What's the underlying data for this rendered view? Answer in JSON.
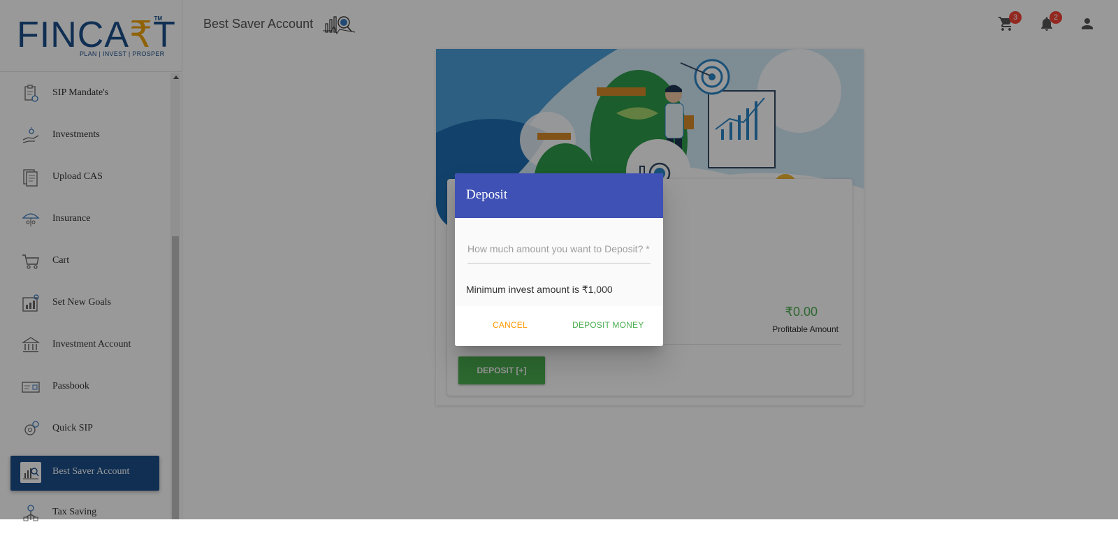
{
  "sidebar": {
    "logo": {
      "text_a": "FINCA",
      "text_rupee": "₹",
      "text_b": "T",
      "tm": "TM",
      "tagline": "PLAN | INVEST | PROSPER"
    },
    "items": [
      {
        "label": "SIP Mandate's",
        "icon": "clipboard-icon"
      },
      {
        "label": "Investments",
        "icon": "hand-money-icon"
      },
      {
        "label": "Upload CAS",
        "icon": "document-upload-icon"
      },
      {
        "label": "Insurance",
        "icon": "umbrella-family-icon"
      },
      {
        "label": "Cart",
        "icon": "cart-icon"
      },
      {
        "label": "Set New Goals",
        "icon": "goal-chart-icon"
      },
      {
        "label": "Investment Account",
        "icon": "bank-icon"
      },
      {
        "label": "Passbook",
        "icon": "passbook-icon"
      },
      {
        "label": "Quick SIP",
        "icon": "gear-money-icon"
      },
      {
        "label": "Best Saver Account",
        "icon": "analytics-icon",
        "active": true
      },
      {
        "label": "Tax Saving",
        "icon": "tax-tree-icon"
      }
    ]
  },
  "header": {
    "title": "Best Saver Account",
    "cart_badge": "3",
    "notification_badge": "2"
  },
  "card": {
    "profit_value": "₹0.00",
    "profit_label": "Profitable Amount",
    "deposit_button": "DEPOSIT [+]"
  },
  "dialog": {
    "title": "Deposit",
    "amount_placeholder": "How much amount you want to Deposit? *",
    "amount_value": "",
    "min_note": "Minimum invest amount is ₹1,000",
    "cancel_label": "CANCEL",
    "deposit_label": "DEPOSIT MONEY"
  },
  "colors": {
    "brand_blue": "#1b4f8a",
    "dialog_header": "#3f51b5",
    "accent_green": "#4caf50",
    "accent_orange": "#ff9800",
    "badge_red": "#f44336"
  }
}
